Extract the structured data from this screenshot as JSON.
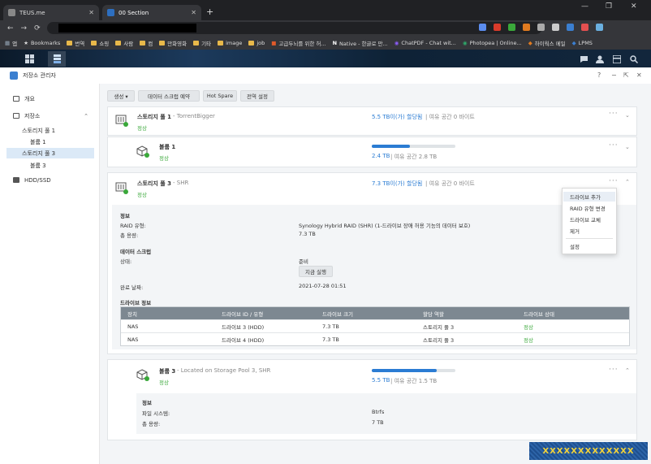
{
  "browser": {
    "tabs": [
      {
        "label": "TEUS.me"
      },
      {
        "label": "00 Section"
      }
    ],
    "new_tab": "+",
    "bookmarks": [
      {
        "label": "앱"
      },
      {
        "label": "Bookmarks"
      },
      {
        "label": "번역"
      },
      {
        "label": "쇼핑"
      },
      {
        "label": "사람"
      },
      {
        "label": "컴"
      },
      {
        "label": "만화영화"
      },
      {
        "label": "기타"
      },
      {
        "label": "image"
      },
      {
        "label": "job"
      },
      {
        "label": "고급두뇌를 위한 허..."
      },
      {
        "label": "Native - 한글로 만..."
      },
      {
        "label": "ChatPDF - Chat wit..."
      },
      {
        "label": "Photopea | Online..."
      },
      {
        "label": "하이웍스 메일"
      },
      {
        "label": "LPMS"
      }
    ]
  },
  "window": {
    "title": "저장소 관리자",
    "help": "?",
    "minimize": "−",
    "restore": "⇱",
    "close": "✕"
  },
  "sidebar": {
    "items": [
      {
        "label": "개요"
      },
      {
        "label": "저장소"
      },
      {
        "label": "스토리지 풀 1"
      },
      {
        "label": "볼륨 1"
      },
      {
        "label": "스토리지 풀 3"
      },
      {
        "label": "볼륨 3"
      },
      {
        "label": "HDD/SSD"
      }
    ]
  },
  "toolbar": {
    "create": "생성 ▾",
    "snapshot": "데이터 스크럽 예약",
    "hotspare": "Hot Spare",
    "global": "전역 설정"
  },
  "pool1": {
    "name": "스토리지 풀 1",
    "sub": " - TorrentBigger",
    "status": "정상",
    "alloc": "5.5 TB이(가) 할당됨",
    "free": " | 여유 공간 0 바이트",
    "volume": {
      "name": "볼륨 1",
      "status": "정상",
      "used": "2.4 TB",
      "free": " | 여유 공간 2.8 TB",
      "fill": 0.46
    }
  },
  "pool3": {
    "name": "스토리지 풀 3",
    "sub": " - SHR",
    "status": "정상",
    "alloc": "7.3 TB이(가) 할당됨",
    "free": " | 여유 공간 0 바이트",
    "info_title": "정보",
    "raid_label": "RAID 유형:",
    "raid_value": "Synology Hybrid RAID (SHR) (1-드라이브 장애 허용 기능의 데이터 보호)",
    "size_label": "총 용량:",
    "size_value": "7.3 TB",
    "scrub_title": "데이터 스크럽",
    "state_label": "상태:",
    "state_value": "준비",
    "run_now": "지금 실행",
    "done_label": "완료 날짜:",
    "done_value": "2021-07-28 01:51",
    "drive_title": "드라이브 정보",
    "columns": [
      "장치",
      "드라이브 ID / 유형",
      "드라이브 크기",
      "할당 역할",
      "드라이브 상태"
    ],
    "rows": [
      [
        "NAS",
        "드라이브 3 (HDD)",
        "7.3 TB",
        "스토리지 풀 3",
        "정상"
      ],
      [
        "NAS",
        "드라이브 4 (HDD)",
        "7.3 TB",
        "스토리지 풀 3",
        "정상"
      ]
    ],
    "volume": {
      "name": "볼륨 3",
      "sub": " - Located on Storage Pool 3, SHR",
      "status": "정상",
      "used": "5.5 TB",
      "free": " | 여유 공간 1.5 TB",
      "fill": 0.78,
      "info_title": "정보",
      "fs_label": "파일 시스템:",
      "fs_value": "Btrfs",
      "size_label": "총 용량:",
      "size_value": "7 TB"
    }
  },
  "menu": {
    "items": [
      "드라이브 추가",
      "RAID 유형 변경",
      "드라이브 교체",
      "제거",
      "설정"
    ]
  },
  "watermark": "XXXXXXXXXXXXX",
  "colors": {
    "accent": "#2b7cd3",
    "ok": "#3aa83a"
  }
}
